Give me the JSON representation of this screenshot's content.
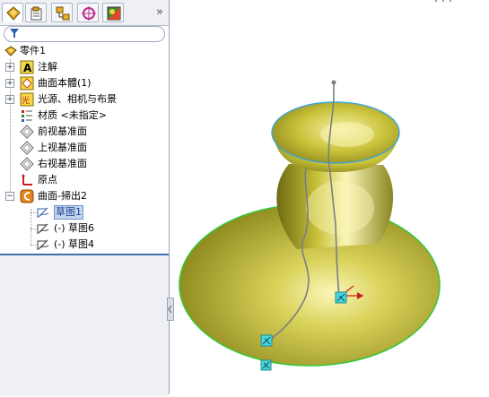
{
  "toolbar": {
    "tabs": [
      {
        "icon": "feature-manager-icon"
      },
      {
        "icon": "property-manager-icon"
      },
      {
        "icon": "configuration-manager-icon"
      },
      {
        "icon": "dimxpert-icon"
      },
      {
        "icon": "display-manager-icon"
      }
    ],
    "more_label": "»"
  },
  "filter": {
    "icon": "filter-icon"
  },
  "tree": {
    "root": {
      "label": "零件1",
      "icon": "part-icon"
    },
    "items": [
      {
        "label": "注解",
        "icon": "annotations-icon",
        "expander": "+"
      },
      {
        "label": "曲面本體(1)",
        "icon": "surface-bodies-icon",
        "expander": "+"
      },
      {
        "label": "光源、相机与布景",
        "icon": "lights-cameras-scene-icon",
        "expander": "+"
      },
      {
        "label": "材质 <未指定>",
        "icon": "material-icon",
        "expander": ""
      },
      {
        "label": "前视基准面",
        "icon": "plane-icon",
        "expander": ""
      },
      {
        "label": "上视基准面",
        "icon": "plane-icon",
        "expander": ""
      },
      {
        "label": "右视基准面",
        "icon": "plane-icon",
        "expander": ""
      },
      {
        "label": "原点",
        "icon": "origin-icon",
        "expander": ""
      },
      {
        "label": "曲面-掃出2",
        "icon": "swept-surface-icon",
        "expander": "−"
      }
    ],
    "children": [
      {
        "label": "草图1",
        "icon": "sketch-icon",
        "selected": true
      },
      {
        "label": "(-) 草图6",
        "icon": "sketch-icon",
        "selected": false
      },
      {
        "label": "(-) 草图4",
        "icon": "sketch-icon",
        "selected": false
      }
    ]
  },
  "colors": {
    "surface_yellow": "#c9c23a",
    "edge_green": "#3ac63a",
    "edge_blue": "#3aa6d8",
    "path_gray": "#7a7f86",
    "selection_blue": "#c5d5ee"
  }
}
